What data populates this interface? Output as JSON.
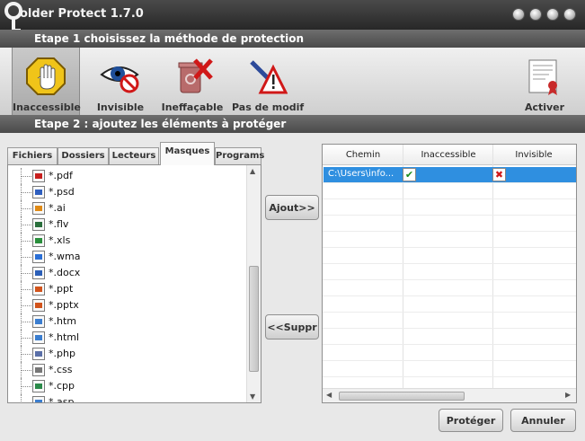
{
  "window": {
    "title": "older Protect 1.7.0"
  },
  "step1": {
    "label": "Etape 1  choisissez la méthode de protection"
  },
  "step2": {
    "label": "Etape 2 : ajoutez les éléments à protéger"
  },
  "toolbar": {
    "items": [
      {
        "label": "Inaccessible",
        "icon": "stop-hand-icon",
        "selected": true
      },
      {
        "label": "Invisible",
        "icon": "eye-forbidden-icon"
      },
      {
        "label": "Ineffaçable",
        "icon": "recycle-bin-delete-icon"
      },
      {
        "label": "Pas de modif",
        "icon": "pen-warning-icon"
      }
    ],
    "activate": {
      "label": "Activer",
      "icon": "certificate-icon"
    }
  },
  "tabs": [
    {
      "label": "Fichiers"
    },
    {
      "label": "Dossiers"
    },
    {
      "label": "Lecteurs"
    },
    {
      "label": "Masques",
      "active": true
    },
    {
      "label": "Programs"
    }
  ],
  "masks": [
    {
      "ext": "*.pdf",
      "color": "#c8201e"
    },
    {
      "ext": "*.psd",
      "color": "#2f5fbf"
    },
    {
      "ext": "*.ai",
      "color": "#e08a16"
    },
    {
      "ext": "*.flv",
      "color": "#2a6f3c"
    },
    {
      "ext": "*.xls",
      "color": "#2a8f3c"
    },
    {
      "ext": "*.wma",
      "color": "#2b6fd6"
    },
    {
      "ext": "*.docx",
      "color": "#2b5fb8"
    },
    {
      "ext": "*.ppt",
      "color": "#d2541c"
    },
    {
      "ext": "*.pptx",
      "color": "#d2541c"
    },
    {
      "ext": "*.htm",
      "color": "#3b7ed0"
    },
    {
      "ext": "*.html",
      "color": "#3b7ed0"
    },
    {
      "ext": "*.php",
      "color": "#5a6fa8"
    },
    {
      "ext": "*.css",
      "color": "#777777"
    },
    {
      "ext": "*.cpp",
      "color": "#2b8a4a"
    },
    {
      "ext": "*.asp",
      "color": "#3b7ed0"
    }
  ],
  "buttons": {
    "add": "Ajout>>",
    "remove": "<<Suppr",
    "protect": "Protéger",
    "cancel": "Annuler"
  },
  "grid": {
    "columns": [
      "Chemin",
      "Inaccessible",
      "Invisible"
    ],
    "rows": [
      {
        "path": "C:\\Users\\info...",
        "inaccessible": "✔",
        "invisible": "✖"
      }
    ]
  },
  "colors": {
    "selection": "#2f8fe0",
    "check": "#1a8a1a",
    "cross": "#d01818"
  }
}
